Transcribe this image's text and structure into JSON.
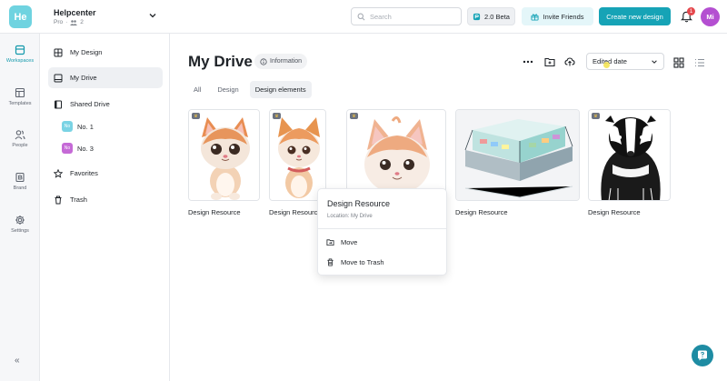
{
  "header": {
    "logo_text": "He",
    "team_name": "Helpcenter",
    "plan": "Pro",
    "member_count": "2",
    "search_placeholder": "Search",
    "beta_label": "2.0 Beta",
    "invite_label": "Invite Friends",
    "create_label": "Create new design",
    "notification_count": "1",
    "avatar_initials": "Mi"
  },
  "rail": {
    "items": [
      {
        "label": "Workspaces",
        "icon": "workspaces-icon",
        "active": true
      },
      {
        "label": "Templates",
        "icon": "templates-icon"
      },
      {
        "label": "People",
        "icon": "people-icon"
      },
      {
        "label": "Brand",
        "icon": "brand-icon"
      },
      {
        "label": "Settings",
        "icon": "gear-icon"
      }
    ],
    "collapse": "«"
  },
  "sidebar": {
    "items": [
      {
        "label": "My Design",
        "icon": "grid-icon"
      },
      {
        "label": "My Drive",
        "icon": "drive-icon",
        "active": true
      },
      {
        "label": "Shared Drive",
        "icon": "shared-drive-icon"
      },
      {
        "label": "Favorites",
        "icon": "star-icon"
      },
      {
        "label": "Trash",
        "icon": "trash-icon"
      }
    ],
    "shared": [
      {
        "badge": "No",
        "label": "No. 1",
        "color": "#7ad3e4"
      },
      {
        "badge": "No",
        "label": "No. 3",
        "color": "#c56ad6"
      }
    ]
  },
  "main": {
    "title": "My Drive",
    "info_label": "Information",
    "sort_label": "Edited date",
    "tabs": [
      {
        "label": "All"
      },
      {
        "label": "Design"
      },
      {
        "label": "Design elements",
        "active": true
      }
    ],
    "cards": [
      {
        "label": "Design Resource",
        "image": "kitten-illustration-1"
      },
      {
        "label": "Design Resource",
        "image": "kitten-illustration-2"
      },
      {
        "label": "Design Resource",
        "image": "kitten-illustration-3"
      },
      {
        "label": "Design Resource",
        "image": "pharmacy-store-illustration"
      },
      {
        "label": "Design Resource",
        "image": "badger-illustration"
      }
    ]
  },
  "context_menu": {
    "title": "Design Resource",
    "location": "Location: My Drive",
    "items": [
      {
        "label": "Move",
        "icon": "move-icon"
      },
      {
        "label": "Move to Trash",
        "icon": "trash-icon"
      }
    ]
  },
  "colors": {
    "accent": "#16a3b6",
    "avatar": "#b44fd1",
    "badge_red": "#e5484d"
  }
}
